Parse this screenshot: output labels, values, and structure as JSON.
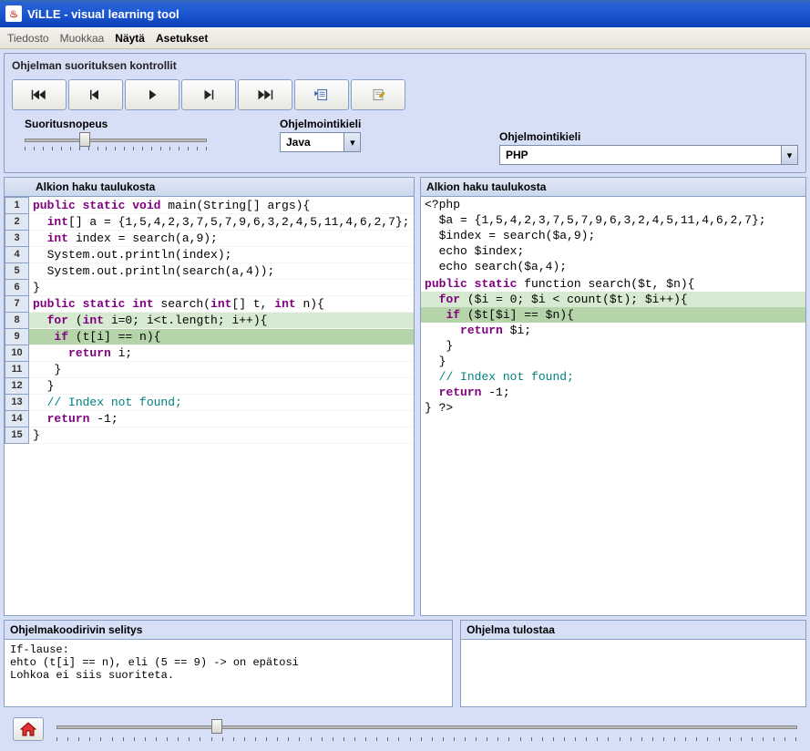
{
  "window": {
    "title": "ViLLE - visual learning tool"
  },
  "menu": {
    "file": "Tiedosto",
    "edit": "Muokkaa",
    "view": "Näytä",
    "settings": "Asetukset"
  },
  "controls": {
    "title": "Ohjelman suorituksen kontrollit",
    "speed_label": "Suoritusnopeus",
    "lang_label": "Ohjelmointikieli",
    "lang_left": "Java",
    "lang_right": "PHP"
  },
  "left_code": {
    "title": "Alkion haku taulukosta",
    "lines": [
      {
        "n": "1",
        "html": "<span class='kw'>public static void</span> main(String[] args){"
      },
      {
        "n": "2",
        "html": "  <span class='kw'>int</span>[] a = {1,5,4,2,3,7,5,7,9,6,3,2,4,5,11,4,6,2,7};"
      },
      {
        "n": "3",
        "html": "  <span class='kw'>int</span> index = search(a,9);"
      },
      {
        "n": "4",
        "html": "  System.out.println(index);"
      },
      {
        "n": "5",
        "html": "  System.out.println(search(a,4));"
      },
      {
        "n": "6",
        "html": "}"
      },
      {
        "n": "7",
        "html": "<span class='kw'>public static int</span> search(<span class='kw'>int</span>[] t, <span class='kw'>int</span> n){"
      },
      {
        "n": "8",
        "html": "  <span class='kw'>for</span> (<span class='kw'>int</span> i=0; i&lt;t.length; i++){",
        "cls": "hl-green"
      },
      {
        "n": "9",
        "html": "   <span class='kw'>if</span> (t[i] == n){",
        "cls": "hl-dark"
      },
      {
        "n": "10",
        "html": "     <span class='kw'>return</span> i;"
      },
      {
        "n": "11",
        "html": "   }"
      },
      {
        "n": "12",
        "html": "  }"
      },
      {
        "n": "13",
        "html": "  <span class='cm'>// Index not found;</span>"
      },
      {
        "n": "14",
        "html": "  <span class='kw'>return</span> -1;"
      },
      {
        "n": "15",
        "html": "}"
      }
    ]
  },
  "right_code": {
    "title": "Alkion haku taulukosta",
    "lines": [
      {
        "html": "&lt;?php"
      },
      {
        "html": "  $a = {1,5,4,2,3,7,5,7,9,6,3,2,4,5,11,4,6,2,7};"
      },
      {
        "html": "  $index = search($a,9);"
      },
      {
        "html": "  echo $index;"
      },
      {
        "html": "  echo search($a,4);"
      },
      {
        "html": ""
      },
      {
        "html": "<span class='kw'>public static</span> function search($t, $n){"
      },
      {
        "html": "  <span class='kw'>for</span> ($i = 0; $i &lt; count($t); $i++){",
        "cls": "hl-green"
      },
      {
        "html": "   <span class='kw'>if</span> ($t[$i] == $n){",
        "cls": "hl-dark"
      },
      {
        "html": "     <span class='kw'>return</span> $i;"
      },
      {
        "html": "   }"
      },
      {
        "html": "  }"
      },
      {
        "html": "  <span class='cm'>// Index not found;</span>"
      },
      {
        "html": "  <span class='kw'>return</span> -1;"
      },
      {
        "html": "} ?&gt;"
      }
    ]
  },
  "explain": {
    "title": "Ohjelmakoodirivin selitys",
    "body": "If-lause:\nehto (t[i] == n), eli (5 == 9) -> on epätosi\nLohkoa ei siis suoriteta."
  },
  "output": {
    "title": "Ohjelma tulostaa",
    "body": ""
  }
}
